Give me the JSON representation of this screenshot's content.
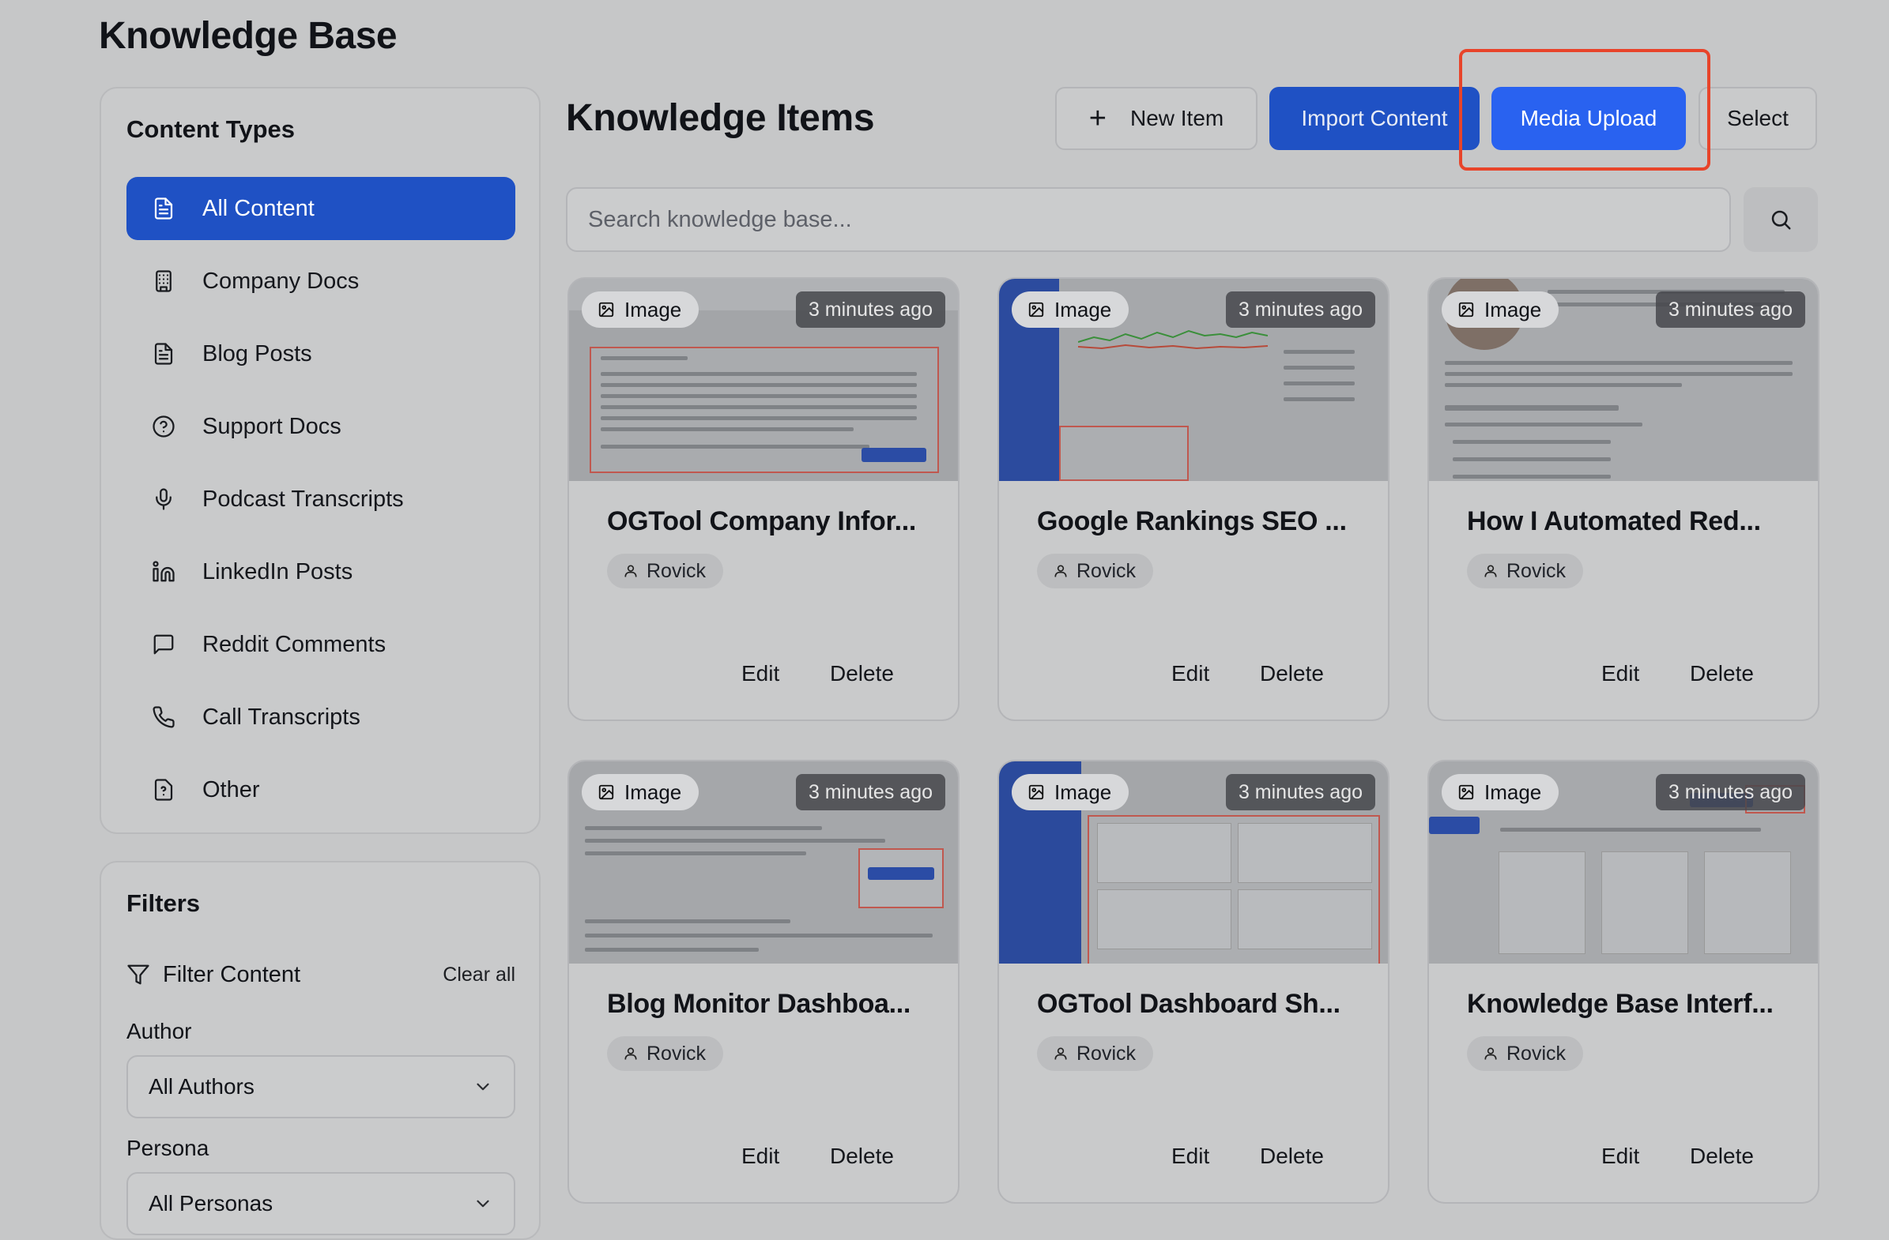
{
  "page": {
    "title": "Knowledge Base"
  },
  "sidebar": {
    "heading": "Content Types",
    "items": [
      {
        "label": "All Content",
        "icon": "document-icon",
        "active": true
      },
      {
        "label": "Company Docs",
        "icon": "building-icon"
      },
      {
        "label": "Blog Posts",
        "icon": "document-icon"
      },
      {
        "label": "Support Docs",
        "icon": "help-circle-icon"
      },
      {
        "label": "Podcast Transcripts",
        "icon": "microphone-icon"
      },
      {
        "label": "LinkedIn Posts",
        "icon": "linkedin-icon"
      },
      {
        "label": "Reddit Comments",
        "icon": "message-square-icon"
      },
      {
        "label": "Call Transcripts",
        "icon": "phone-icon"
      },
      {
        "label": "Other",
        "icon": "file-question-icon"
      }
    ]
  },
  "filters": {
    "heading": "Filters",
    "filter_label": "Filter Content",
    "clear_label": "Clear all",
    "author_label": "Author",
    "author_value": "All Authors",
    "persona_label": "Persona",
    "persona_value": "All Personas"
  },
  "main": {
    "title": "Knowledge Items",
    "new_item_label": "New Item",
    "import_label": "Import Content",
    "media_upload_label": "Media Upload",
    "select_label": "Select",
    "search_placeholder": "Search knowledge base..."
  },
  "cards": [
    {
      "type": "Image",
      "time": "3 minutes ago",
      "title": "OGTool Company Infor...",
      "author": "Rovick",
      "edit": "Edit",
      "delete": "Delete"
    },
    {
      "type": "Image",
      "time": "3 minutes ago",
      "title": "Google Rankings SEO ...",
      "author": "Rovick",
      "edit": "Edit",
      "delete": "Delete"
    },
    {
      "type": "Image",
      "time": "3 minutes ago",
      "title": "How I Automated Red...",
      "author": "Rovick",
      "edit": "Edit",
      "delete": "Delete"
    },
    {
      "type": "Image",
      "time": "3 minutes ago",
      "title": "Blog Monitor Dashboa...",
      "author": "Rovick",
      "edit": "Edit",
      "delete": "Delete"
    },
    {
      "type": "Image",
      "time": "3 minutes ago",
      "title": "OGTool Dashboard Sh...",
      "author": "Rovick",
      "edit": "Edit",
      "delete": "Delete"
    },
    {
      "type": "Image",
      "time": "3 minutes ago",
      "title": "Knowledge Base Interf...",
      "author": "Rovick",
      "edit": "Edit",
      "delete": "Delete"
    }
  ],
  "colors": {
    "accent": "#2962f0",
    "active_nav": "#1f51c4",
    "highlight_border": "#e8442a",
    "overlay_background": "#c6c7c8"
  }
}
